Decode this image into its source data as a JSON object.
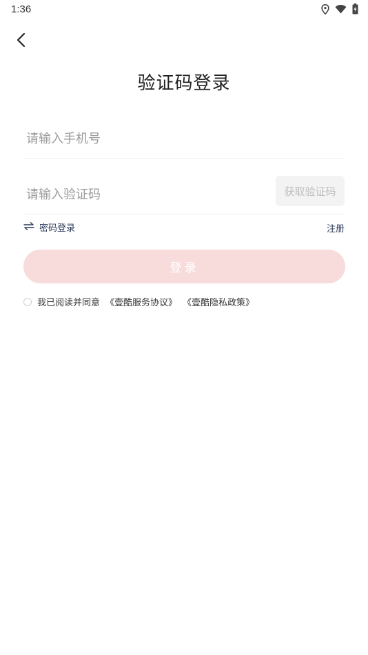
{
  "status_bar": {
    "time": "1:36",
    "icons": [
      "location-icon",
      "wifi-icon",
      "battery-charging-icon"
    ]
  },
  "header": {
    "back_icon": "chevron-left-icon",
    "title": "验证码登录"
  },
  "form": {
    "phone_placeholder": "请输入手机号",
    "code_placeholder": "请输入验证码",
    "get_code_label": "获取验证码"
  },
  "links": {
    "switch_icon": "swap-arrows-icon",
    "password_login": "密码登录",
    "register": "注册"
  },
  "login_button": {
    "label": "登录"
  },
  "agreement": {
    "prefix": "我已阅读并同意",
    "service_agreement": "《壹酷服务协议》",
    "privacy_policy": "《壹酷隐私政策》"
  },
  "colors": {
    "login_button_bg": "#f8dcdc",
    "link_text": "#2b3a5a",
    "placeholder": "#9a9a9a"
  }
}
